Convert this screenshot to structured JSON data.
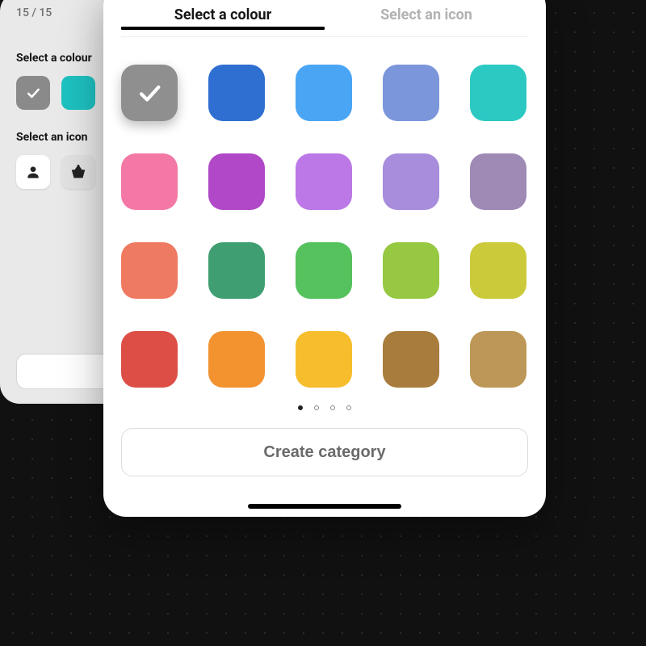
{
  "back_card": {
    "counter": "15 / 15",
    "colour_label": "Select a colour",
    "icon_label": "Select an icon",
    "swatches": [
      {
        "hex": "#8a8a8a",
        "selected": true
      },
      {
        "hex": "#1ec0c0",
        "selected": false
      }
    ]
  },
  "tabs": {
    "colour": "Select a colour",
    "icon": "Select an icon",
    "active": "colour"
  },
  "colours": [
    {
      "hex": "#8f8f8f",
      "selected": true
    },
    {
      "hex": "#2f6fd1",
      "selected": false
    },
    {
      "hex": "#4aa6f5",
      "selected": false
    },
    {
      "hex": "#7c96dc",
      "selected": false
    },
    {
      "hex": "#2cc9c3",
      "selected": false
    },
    {
      "hex": "#f478a6",
      "selected": false
    },
    {
      "hex": "#b048c7",
      "selected": false
    },
    {
      "hex": "#bb78e6",
      "selected": false
    },
    {
      "hex": "#a78ddb",
      "selected": false
    },
    {
      "hex": "#9e8ab5",
      "selected": false
    },
    {
      "hex": "#ef7a62",
      "selected": false
    },
    {
      "hex": "#3f9e72",
      "selected": false
    },
    {
      "hex": "#55c25d",
      "selected": false
    },
    {
      "hex": "#96c842",
      "selected": false
    },
    {
      "hex": "#cbca3a",
      "selected": false
    },
    {
      "hex": "#dd4e46",
      "selected": false
    },
    {
      "hex": "#f29330",
      "selected": false
    },
    {
      "hex": "#f6bd2c",
      "selected": false
    },
    {
      "hex": "#a87c3c",
      "selected": false
    },
    {
      "hex": "#bd9757",
      "selected": false
    }
  ],
  "pagination": {
    "count": 4,
    "active": 0
  },
  "create_label": "Create category"
}
